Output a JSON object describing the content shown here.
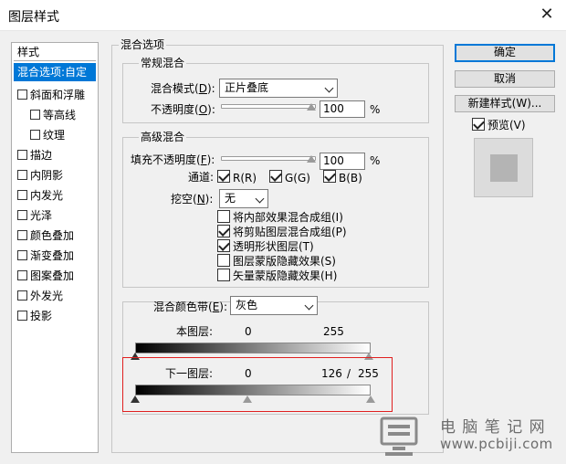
{
  "window": {
    "title": "图层样式",
    "close": "✕"
  },
  "left": {
    "header": "样式",
    "items": [
      {
        "label": "混合选项:自定",
        "checkbox": false,
        "selected": true
      },
      {
        "label": "斜面和浮雕",
        "checkbox": true
      },
      {
        "label": "等高线",
        "checkbox": true,
        "sub": true
      },
      {
        "label": "纹理",
        "checkbox": true,
        "sub": true
      },
      {
        "label": "描边",
        "checkbox": true
      },
      {
        "label": "内阴影",
        "checkbox": true
      },
      {
        "label": "内发光",
        "checkbox": true
      },
      {
        "label": "光泽",
        "checkbox": true
      },
      {
        "label": "颜色叠加",
        "checkbox": true
      },
      {
        "label": "渐变叠加",
        "checkbox": true
      },
      {
        "label": "图案叠加",
        "checkbox": true
      },
      {
        "label": "外发光",
        "checkbox": true
      },
      {
        "label": "投影",
        "checkbox": true
      }
    ]
  },
  "blend": {
    "title": "混合选项",
    "general": {
      "title": "常规混合",
      "mode_label": "混合模式(",
      "mode_key": "D",
      "mode_value": "正片叠底",
      "opacity_label": "不透明度(",
      "opacity_key": "O",
      "opacity_value": "100",
      "opacity_unit": "%"
    },
    "advanced": {
      "title": "高级混合",
      "fill_label": "填充不透明度(",
      "fill_key": "F",
      "fill_value": "100",
      "fill_unit": "%",
      "channels_label": "通道:",
      "channels": [
        "R(R)",
        "G(G)",
        "B(B)"
      ],
      "knockout_label": "挖空(",
      "knockout_key": "N",
      "knockout_value": "无",
      "options": [
        {
          "label": "将内部效果混合成组(I)",
          "checked": false
        },
        {
          "label": "将剪贴图层混合成组(P)",
          "checked": true
        },
        {
          "label": "透明形状图层(T)",
          "checked": true
        },
        {
          "label": "图层蒙版隐藏效果(S)",
          "checked": false
        },
        {
          "label": "矢量蒙版隐藏效果(H)",
          "checked": false
        }
      ]
    },
    "band": {
      "label": "混合颜色带(",
      "key": "E",
      "value": "灰色",
      "this_layer": {
        "label": "本图层:",
        "low": "0",
        "high": "255"
      },
      "underlying": {
        "label": "下一图层:",
        "low": "0",
        "mid": "126",
        "slash": "/",
        "high": "255"
      }
    }
  },
  "right": {
    "ok": "确定",
    "cancel": "取消",
    "new_style": "新建样式(W)...",
    "preview_label": "预览(V)",
    "preview_checked": true
  },
  "watermark": {
    "line1": "电 脑 笔 记 网",
    "line2": "www.pcbiji.com"
  }
}
